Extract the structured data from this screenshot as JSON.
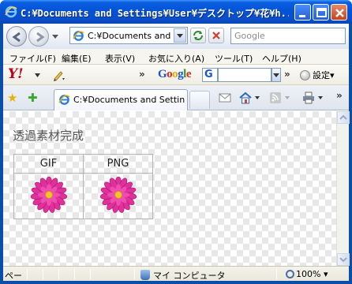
{
  "window": {
    "title": "C:¥Documents and Settings¥User¥デスクトップ¥花¥h..."
  },
  "address_bar": {
    "value": "C:¥Documents and S",
    "search_placeholder": "Google"
  },
  "menu": {
    "items": [
      "ファイル(F)",
      "編集(E)",
      "表示(V)",
      "お気に入り(A)",
      "ツール(T)",
      "ヘルプ(H)"
    ]
  },
  "yahoo_toolbar": {
    "logo": "Y!",
    "google_logo": "Google",
    "google_select": "G",
    "chevron": "»",
    "settings_label": "設定"
  },
  "tabs": {
    "active_title": "C:¥Documents and Settin..."
  },
  "page": {
    "heading": "透過素材完成",
    "table": {
      "headers": [
        "GIF",
        "PNG"
      ]
    }
  },
  "status_bar": {
    "text": "ペー",
    "zone": "マイ コンピュータ",
    "zoom": "100%"
  },
  "colors": {
    "title_bar": "#0453d6",
    "flower": "#e0309a"
  }
}
